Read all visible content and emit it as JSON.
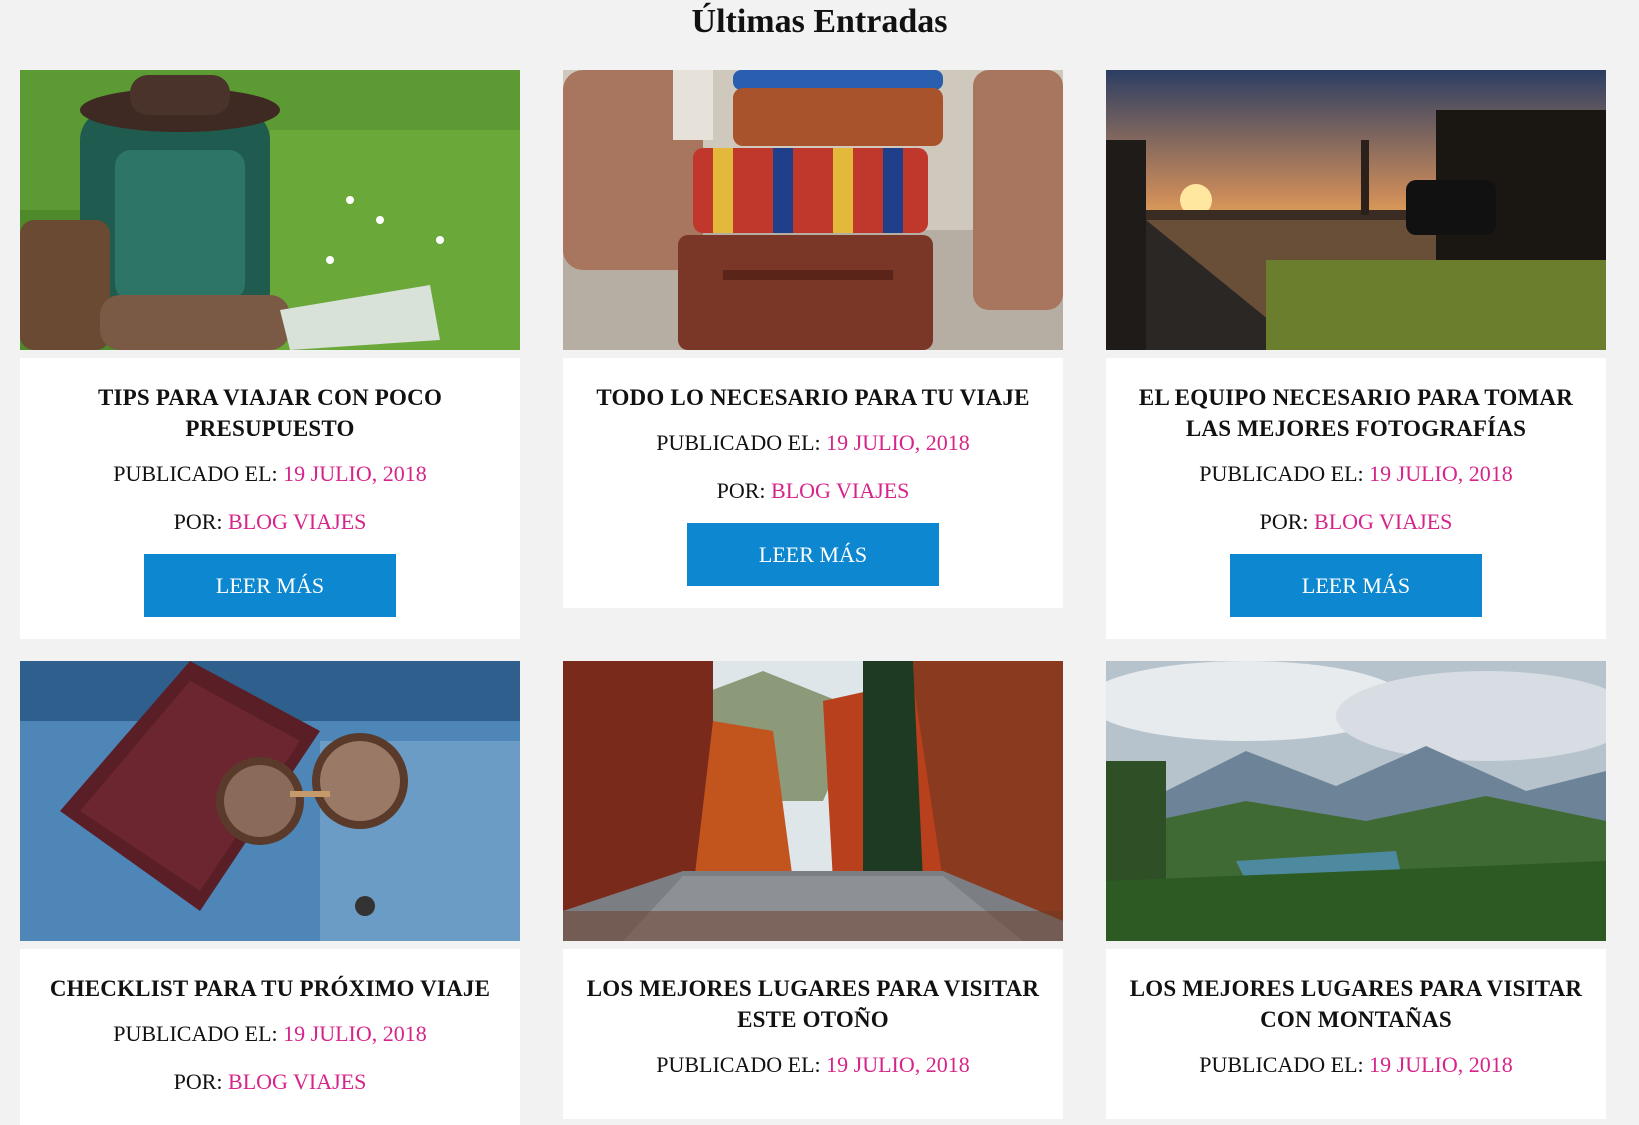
{
  "section": {
    "title": "Últimas Entradas"
  },
  "labels": {
    "published": "PUBLICADO EL:",
    "by": "POR:",
    "read_more": "LEER MÁS"
  },
  "posts": [
    {
      "title": "TIPS PARA VIAJAR CON POCO PRESUPUESTO",
      "date": "19 JULIO, 2018",
      "author": "BLOG VIAJES",
      "image": "backpack-hat-boots-photo"
    },
    {
      "title": "TODO LO NECESARIO PARA TU VIAJE",
      "date": "19 JULIO, 2018",
      "author": "BLOG VIAJES",
      "image": "stacked-suitcases-photo"
    },
    {
      "title": "EL EQUIPO NECESARIO PARA TOMAR LAS MEJORES FOTOGRAFÍAS",
      "date": "19 JULIO, 2018",
      "author": "BLOG VIAJES",
      "image": "photographer-sunset-photo"
    },
    {
      "title": "CHECKLIST PARA TU PRÓXIMO VIAJE",
      "date": "19 JULIO, 2018",
      "author": "BLOG VIAJES",
      "image": "passport-sunglasses-photo"
    },
    {
      "title": "LOS MEJORES LUGARES PARA VISITAR ESTE OTOÑO",
      "date": "19 JULIO, 2018",
      "author": "",
      "image": "autumn-road-photo"
    },
    {
      "title": "LOS MEJORES LUGARES PARA VISITAR CON MONTAÑAS",
      "date": "19 JULIO, 2018",
      "author": "",
      "image": "mountain-lake-photo"
    }
  ],
  "colors": {
    "background": "#f2f2f2",
    "link": "#d6248a",
    "button": "#0d88d0",
    "card": "#ffffff"
  }
}
